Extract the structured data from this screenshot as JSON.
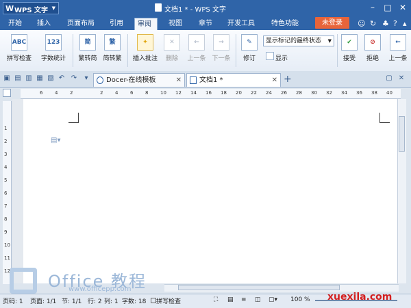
{
  "app": {
    "menu_label": "WPS 文字",
    "menu_logo": "W",
    "doc_title": "文档1 * - WPS 文字"
  },
  "window_controls": {
    "minimize": "–",
    "maximize": "□",
    "close": "✕"
  },
  "menu_tabs": [
    "开始",
    "插入",
    "页面布局",
    "引用",
    "审阅",
    "视图",
    "章节",
    "开发工具",
    "特色功能"
  ],
  "login_label": "未登录",
  "ribbon": {
    "spell_check": "拼写检查",
    "word_count": "字数统计",
    "trad_to_simp": "繁转简",
    "simp_to_trad": "简转繁",
    "insert_comment": "插入批注",
    "delete": "删除",
    "prev_item": "上一条",
    "next_item": "下一条",
    "revise": "修订",
    "display_mode": "显示标记的最终状态",
    "show": "显示",
    "accept": "接受",
    "reject": "拒绝",
    "prev": "上一条",
    "icon_abc": "ABC",
    "icon_123": "123",
    "icon_jian": "简",
    "icon_fan": "繁"
  },
  "doc_tabs": [
    {
      "label": "Docer-在线模板"
    },
    {
      "label": "文档1 *"
    }
  ],
  "ruler": {
    "ticks": [
      "6",
      "4",
      "2",
      "",
      "2",
      "4",
      "6",
      "8",
      "10",
      "12",
      "14",
      "16",
      "18",
      "20",
      "22",
      "24",
      "26",
      "28",
      "30",
      "32",
      "34",
      "36",
      "38",
      "40"
    ],
    "vticks": [
      "1",
      "2",
      "3",
      "4",
      "5",
      "6",
      "7",
      "8",
      "9",
      "10",
      "11",
      "12"
    ]
  },
  "status": {
    "page_num": "页码: 1",
    "pages": "页面: 1/1",
    "section": "节: 1/1",
    "row": "行: 2",
    "col": "列: 1",
    "words": "字数: 18",
    "spell": "拼写检查",
    "zoom": "100 %"
  },
  "watermark": {
    "text": "Office 教程",
    "url": "www.officepp.com"
  },
  "site_mark": "xuexila.com"
}
